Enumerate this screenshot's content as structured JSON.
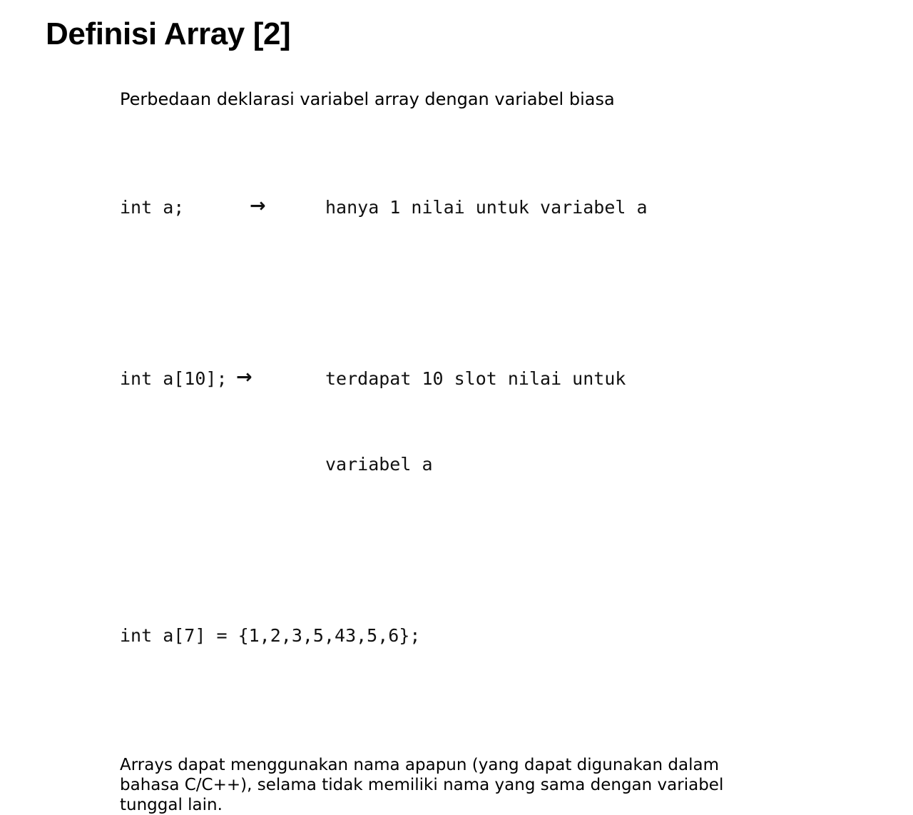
{
  "slide": {
    "title": "Definisi Array [2]",
    "background_color": "#ffffff",
    "text_color": "#000000",
    "intro": "Perbedaan deklarasi variabel array dengan variabel biasa",
    "code_lines": [
      {
        "declaration": "int a;",
        "arrow": "→",
        "description": "hanya 1 nilai untuk variabel a",
        "continuation": ""
      },
      {
        "declaration": "int a[10];",
        "arrow": "→",
        "description": "terdapat 10 slot nilai untuk",
        "continuation": "variabel a"
      }
    ],
    "code_initializer": "int a[7] = {1,2,3,5,43,5,6};",
    "closing": "Arrays dapat menggunakan nama apapun (yang dapat digunakan dalam bahasa C/C++), selama tidak memiliki nama yang sama dengan variabel tunggal lain."
  }
}
